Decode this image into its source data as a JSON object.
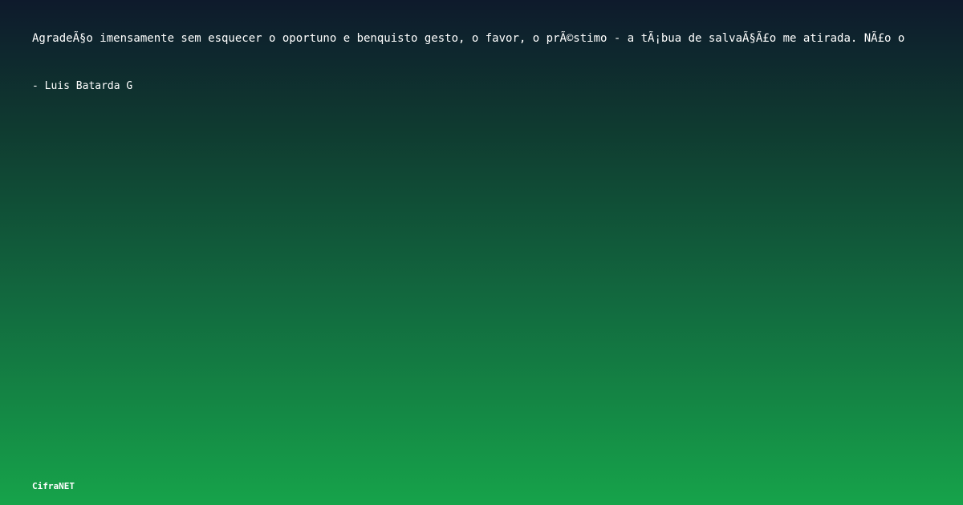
{
  "quote": {
    "text": "AgradeÃ§o imensamente sem esquecer o oportuno e benquisto gesto, o favor, o prÃ©stimo - a tÃ¡bua de salvaÃ§Ã£o me atirada. NÃ£o o"
  },
  "author": {
    "text": "- Luis Batarda G"
  },
  "brand": {
    "text": "CifraNET"
  }
}
